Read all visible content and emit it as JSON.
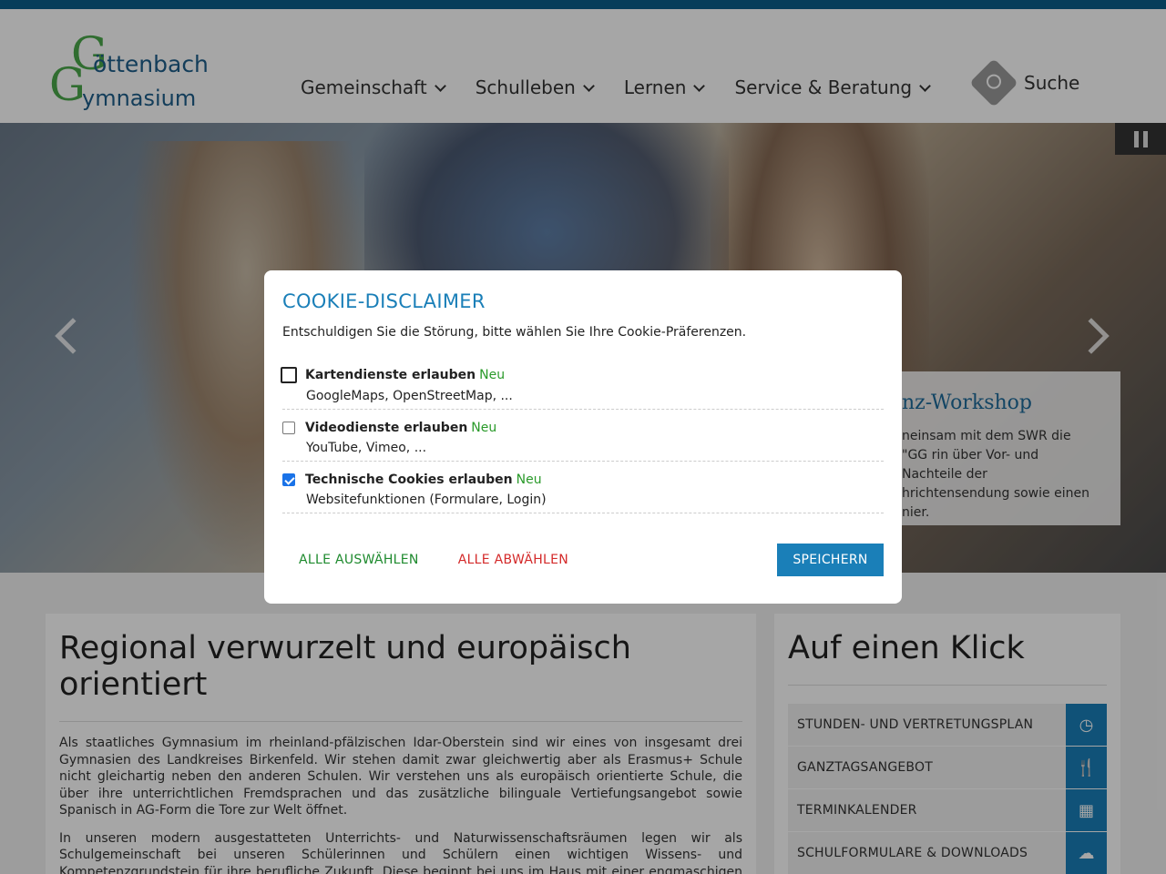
{
  "logo": {
    "g1": "G",
    "word1": "öttenbach",
    "g2": "G",
    "word2": "ymnasium"
  },
  "nav": {
    "items": [
      {
        "label": "Gemeinschaft"
      },
      {
        "label": "Schulleben"
      },
      {
        "label": "Lernen"
      },
      {
        "label": "Service & Beratung"
      }
    ]
  },
  "search": {
    "label": "Suche"
  },
  "slider": {
    "caption_title": "nz-Workshop",
    "caption_text": "neinsam mit dem SWR die \"GG rin über Vor- und Nachteile der hrichtensendung sowie einen nier."
  },
  "main": {
    "title": "Regional verwurzelt und europäisch orientiert",
    "para1": "Als staatliches Gymnasium im rheinland-pfälzischen Idar-Oberstein sind wir eines von insgesamt drei Gymnasien des Landkreises Birkenfeld. Wir stehen damit zwar gleichwertig aber als Erasmus+ Schule nicht gleichartig neben den anderen Schulen. Wir verstehen uns als europäisch orientierte Schule, die über ihre unterrichtlichen Fremdsprachen und das zusätzliche bilinguale Vertiefungsangebot sowie Spanisch in AG-Form die Tore zur Welt öffnet.",
    "para2": "In unseren modern ausgestatteten Unterrichts- und Naturwissenschaftsräumen legen wir als Schulgemeinschaft bei unseren Schülerinnen und Schülern einen wichtigen Wissens- und Kompetenzgrundstein für ihre berufliche Zukunft. Diese beginnt bei uns im Haus mit einer engmaschigen und ausgeprägten Studien- und Berufsberatung und ergänzt diverse außerschulische Berufspraktika und Informationsveranstaltungen."
  },
  "quick": {
    "title": "Auf einen Klick",
    "items": [
      {
        "label": "STUNDEN- UND VERTRETUNGSPLAN",
        "icon": "clock-icon",
        "glyph": "◷"
      },
      {
        "label": "GANZTAGSANGEBOT",
        "icon": "cutlery-icon",
        "glyph": "🍴"
      },
      {
        "label": "TERMINKALENDER",
        "icon": "calendar-icon",
        "glyph": "▦"
      },
      {
        "label": "SCHULFORMULARE & DOWNLOADS",
        "icon": "cloud-download-icon",
        "glyph": "☁"
      }
    ]
  },
  "cookie": {
    "title": "COOKIE-DISCLAIMER",
    "subtitle": "Entschuldigen Sie die Störung, bitte wählen Sie Ihre Cookie-Präferenzen.",
    "options": [
      {
        "label": "Kartendienste erlauben",
        "badge": "Neu",
        "desc": "GoogleMaps, OpenStreetMap, ...",
        "checked": false
      },
      {
        "label": "Videodienste erlauben",
        "badge": "Neu",
        "desc": "YouTube, Vimeo, ...",
        "checked": false
      },
      {
        "label": "Technische Cookies erlauben",
        "badge": "Neu",
        "desc": "Websitefunktionen (Formulare, Login)",
        "checked": true
      }
    ],
    "select_all": "ALLE AUSWÄHLEN",
    "deselect_all": "ALLE ABWÄHLEN",
    "save": "SPEICHERN"
  },
  "colors": {
    "brand_blue": "#1a7fb8",
    "brand_green": "#4aa84a",
    "danger_red": "#d42a2a",
    "topbar": "#0a5e8a"
  }
}
